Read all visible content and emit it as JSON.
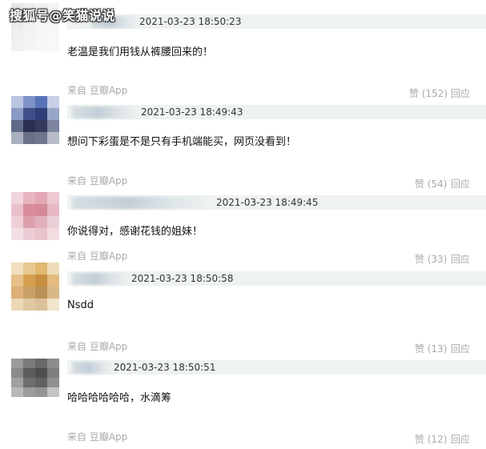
{
  "watermark": "搜狐号@笑猫说说",
  "comments": [
    {
      "time": "2021-03-23 18:50:23",
      "text": "老温是我们用钱从裤腰回来的！",
      "source": "来自 豆瓣App",
      "like": "赞 (152)",
      "reply": "回应",
      "avatar": [
        "#e6e8ea",
        "#eceef0",
        "#f0f1f2",
        "#f3f4f5",
        "#e9ebed",
        "#f1f2f3",
        "#f5f6f7",
        "#f6f7f8",
        "#eceef0",
        "#f2f3f4",
        "#f5f6f6",
        "#f7f8f8",
        "#f0f1f2",
        "#f4f5f6",
        "#f6f7f7",
        "#f8f8f9"
      ]
    },
    {
      "time": "2021-03-23 18:49:43",
      "text": "想问下彩蛋是不是只有手机端能买，网页没看到！",
      "source": "来自 豆瓣App",
      "like": "赞 (54)",
      "reply": "回应",
      "avatar": [
        "#b9c4e0",
        "#7f93c8",
        "#5a73b8",
        "#c8d0e6",
        "#8a9ac4",
        "#3e4f8a",
        "#2f3f78",
        "#9aa6c8",
        "#5f6a8a",
        "#2a3050",
        "#343b5e",
        "#7c84a0",
        "#aab0c0",
        "#6a7088",
        "#70768c",
        "#b8bcc8"
      ]
    },
    {
      "time": "2021-03-23 18:49:45",
      "text": "你说得对，感谢花钱的姐妹！",
      "source": "来自 豆瓣App",
      "like": "赞 (33)",
      "reply": "回应",
      "avatar": [
        "#f2d4dc",
        "#e8b4c0",
        "#e2a8b4",
        "#ecc8d0",
        "#eac0cc",
        "#d88c9c",
        "#d48898",
        "#e6b8c4",
        "#f0d0d8",
        "#dca0ac",
        "#e2b0bc",
        "#ead0d6",
        "#f4e0e4",
        "#ecccd4",
        "#e8c4cc",
        "#f2dce0"
      ]
    },
    {
      "time": "2021-03-23 18:50:58",
      "text": "Nsdd",
      "source": "来自 豆瓣App",
      "like": "赞 (13)",
      "reply": "回应",
      "avatar": [
        "#f0e0c0",
        "#e8c890",
        "#e0b870",
        "#eedcb8",
        "#e8c088",
        "#d4a050",
        "#c89040",
        "#e4bc80",
        "#dcb078",
        "#c8a068",
        "#b89058",
        "#d8b888",
        "#ecd8b8",
        "#e0c8a0",
        "#dcc098",
        "#f0e4cc"
      ]
    },
    {
      "time": "2021-03-23 18:50:51",
      "text": "哈哈哈哈哈哈，水滴筹",
      "source": "来自 豆瓣App",
      "like": "赞 (12)",
      "reply": "回应",
      "avatar": [
        "#9a9a9a",
        "#7a7a7a",
        "#686868",
        "#8c8c8c",
        "#8a8a8a",
        "#5c5c5c",
        "#4e4e4e",
        "#7e7e7e",
        "#a0a0a0",
        "#6e6e6e",
        "#626262",
        "#909090",
        "#b8b8b8",
        "#9c9c9c",
        "#949494",
        "#c4c4c4"
      ]
    }
  ]
}
